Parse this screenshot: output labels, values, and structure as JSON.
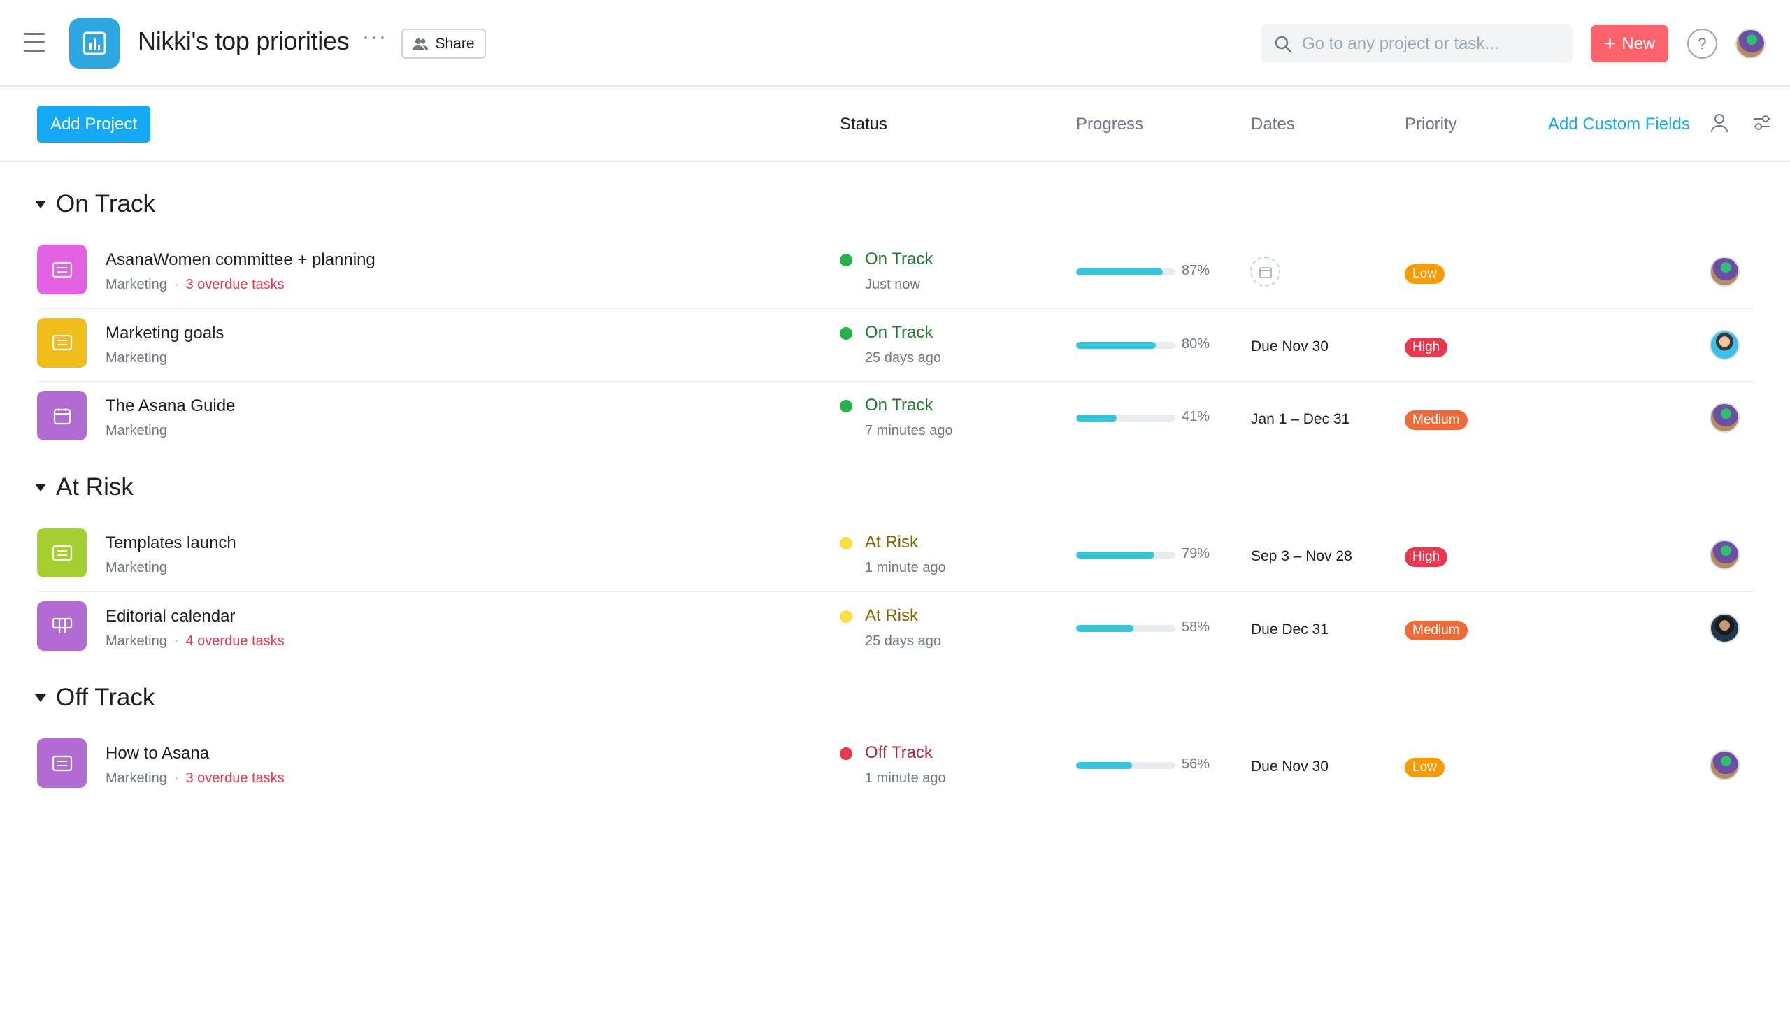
{
  "header": {
    "title": "Nikki's top priorities",
    "more": "···",
    "share_label": "Share",
    "search_placeholder": "Go to any project or task...",
    "new_label": "New",
    "help": "?"
  },
  "toolbar": {
    "add_project_label": "Add Project",
    "columns": {
      "status": "Status",
      "progress": "Progress",
      "dates": "Dates",
      "priority": "Priority",
      "add_fields": "Add Custom Fields"
    }
  },
  "colors": {
    "on_track": "#25b24a",
    "at_risk": "#f8df42",
    "off_track": "#e8384f",
    "on_track_text": "#1f7a2f",
    "at_risk_text": "#7a6a00",
    "off_track_text": "#b02a3c",
    "low": "#fd9a00",
    "high": "#e8384f",
    "medium": "#f06a37"
  },
  "sections": [
    {
      "title": "On Track",
      "rows": [
        {
          "name": "AsanaWomen committee + planning",
          "team": "Marketing",
          "overdue": "3 overdue tasks",
          "icon_color": "#e362e3",
          "icon": "list-icon",
          "status": "On Track",
          "status_time": "Just now",
          "progress": 87,
          "progress_label": "87%",
          "date": "",
          "priority": "Low"
        },
        {
          "name": "Marketing goals",
          "team": "Marketing",
          "overdue": "",
          "icon_color": "#f1bd1b",
          "icon": "list-icon",
          "status": "On Track",
          "status_time": "25 days ago",
          "progress": 80,
          "progress_label": "80%",
          "date": "Due Nov 30",
          "priority": "High"
        },
        {
          "name": "The Asana Guide",
          "team": "Marketing",
          "overdue": "",
          "icon_color": "#b36bd4",
          "icon": "calendar-icon",
          "status": "On Track",
          "status_time": "7 minutes ago",
          "progress": 41,
          "progress_label": "41%",
          "date": "Jan 1 – Dec 31",
          "priority": "Medium"
        }
      ]
    },
    {
      "title": "At Risk",
      "rows": [
        {
          "name": "Templates launch",
          "team": "Marketing",
          "overdue": "",
          "icon_color": "#a4cf30",
          "icon": "list-icon",
          "status": "At Risk",
          "status_time": "1 minute ago",
          "progress": 79,
          "progress_label": "79%",
          "date": "Sep 3 – Nov 28",
          "priority": "High"
        },
        {
          "name": "Editorial calendar",
          "team": "Marketing",
          "overdue": "4 overdue tasks",
          "icon_color": "#b36bd4",
          "icon": "board-icon",
          "status": "At Risk",
          "status_time": "25 days ago",
          "progress": 58,
          "progress_label": "58%",
          "date": "Due Dec 31",
          "priority": "Medium"
        }
      ]
    },
    {
      "title": "Off Track",
      "rows": [
        {
          "name": "How to Asana",
          "team": "Marketing",
          "overdue": "3 overdue tasks",
          "icon_color": "#b36bd4",
          "icon": "list-icon",
          "status": "Off Track",
          "status_time": "1 minute ago",
          "progress": 56,
          "progress_label": "56%",
          "date": "Due Nov 30",
          "priority": "Low"
        }
      ]
    }
  ]
}
